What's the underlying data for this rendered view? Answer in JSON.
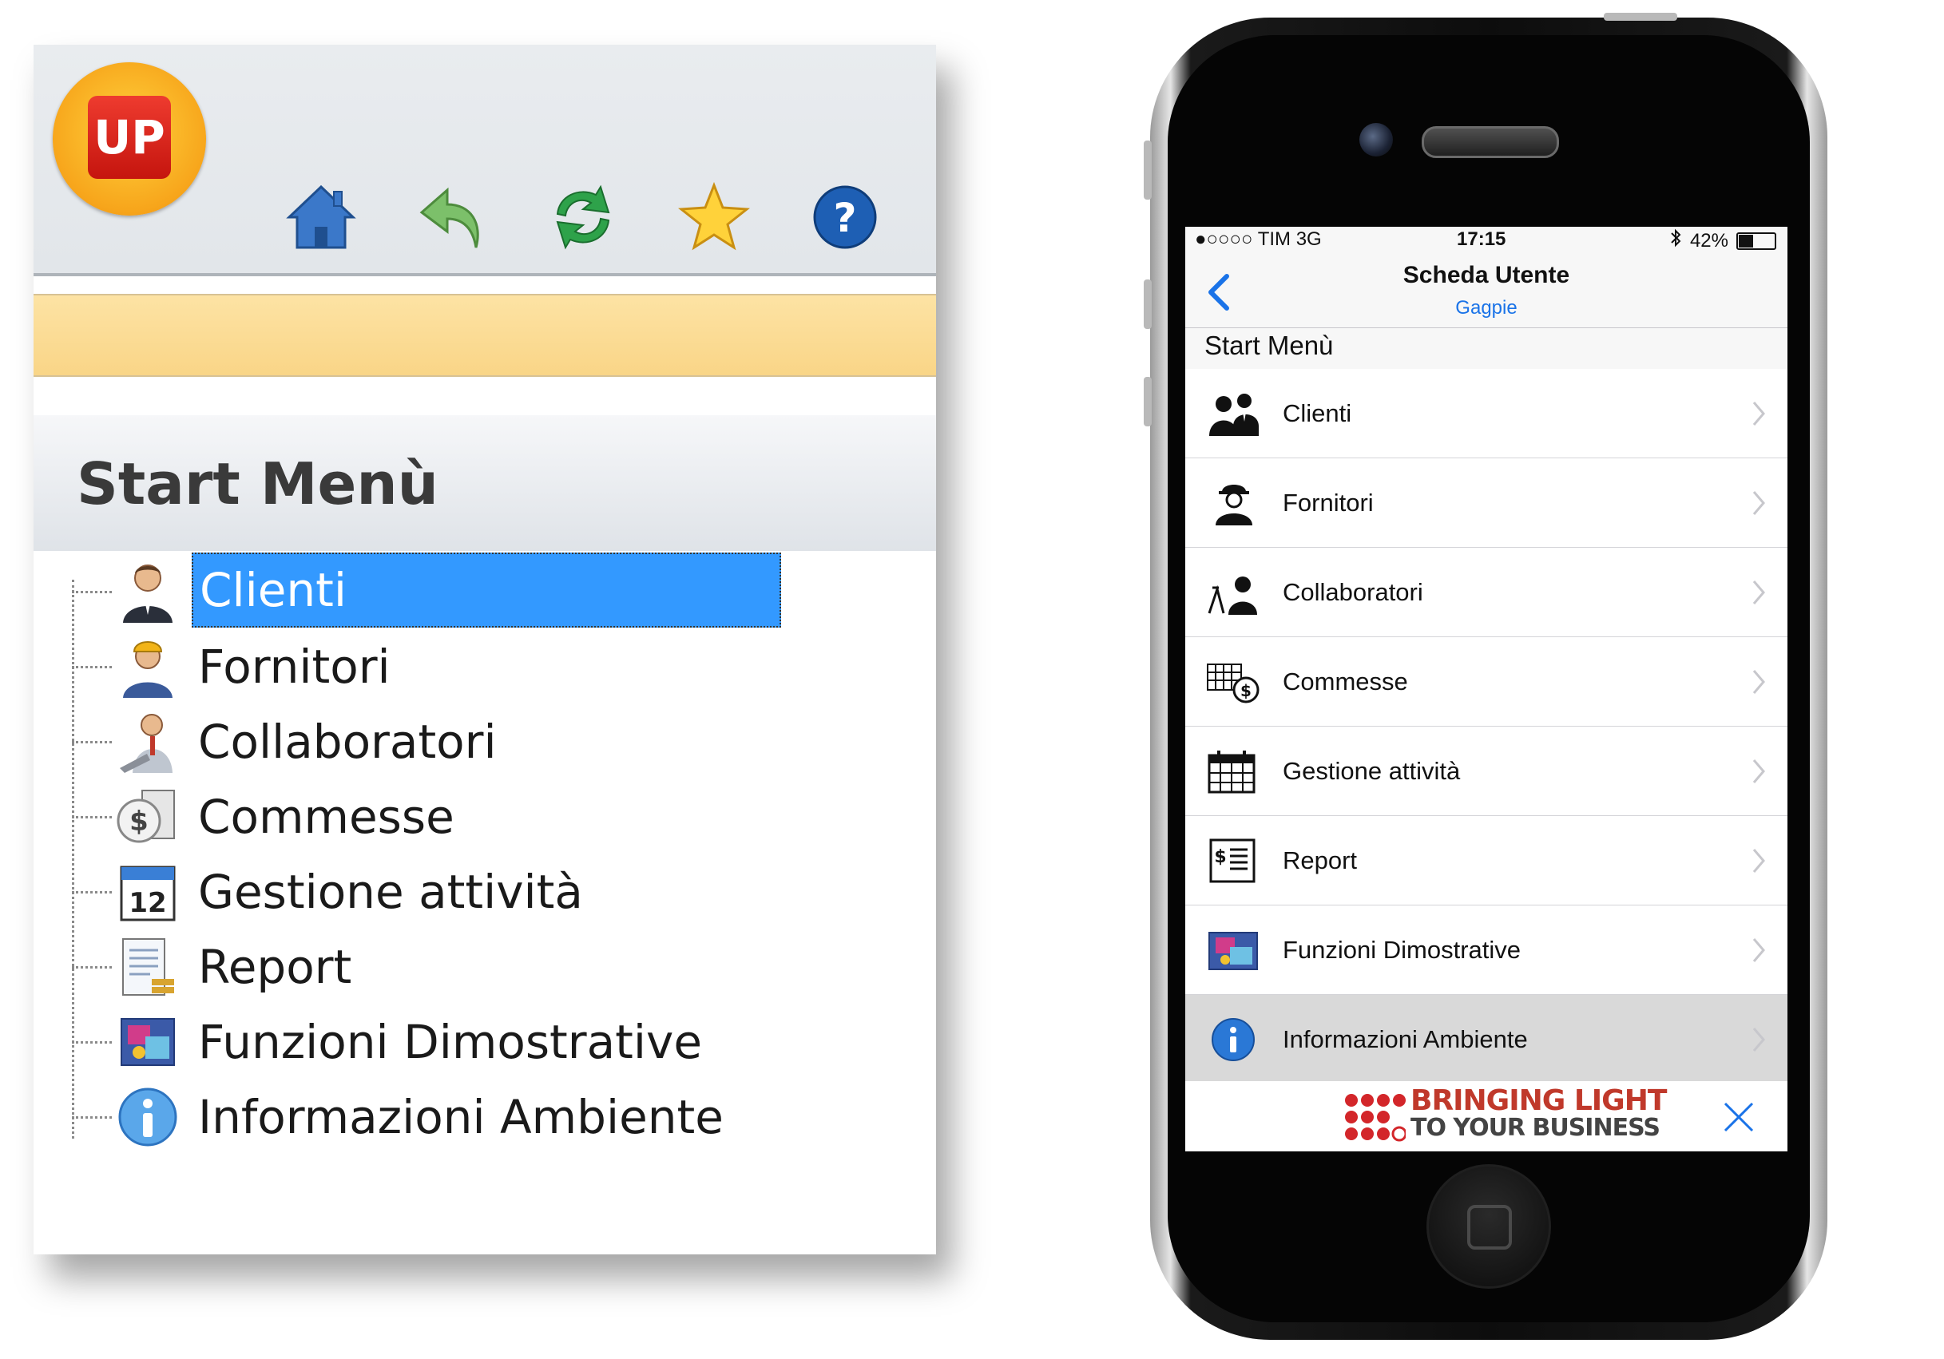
{
  "desktop": {
    "logo_text": "UP",
    "toolbar": [
      {
        "name": "home-button",
        "icon": "home-icon"
      },
      {
        "name": "back-button",
        "icon": "back-arrow-icon"
      },
      {
        "name": "refresh-button",
        "icon": "refresh-icon"
      },
      {
        "name": "favorites-button",
        "icon": "star-icon"
      },
      {
        "name": "help-button",
        "icon": "help-icon"
      }
    ],
    "section_title": "Start Menù",
    "menu": [
      {
        "label": "Clienti",
        "icon": "client-icon",
        "selected": true
      },
      {
        "label": "Fornitori",
        "icon": "supplier-icon"
      },
      {
        "label": "Collaboratori",
        "icon": "collaborator-icon"
      },
      {
        "label": "Commesse",
        "icon": "order-icon"
      },
      {
        "label": "Gestione attività",
        "icon": "calendar-icon"
      },
      {
        "label": "Report",
        "icon": "report-icon"
      },
      {
        "label": "Funzioni Dimostrative",
        "icon": "demo-icon"
      },
      {
        "label": "Informazioni Ambiente",
        "icon": "info-icon"
      }
    ]
  },
  "phone": {
    "status": {
      "carrier": "●○○○○ TIM   3G",
      "time": "17:15",
      "battery": "42%",
      "battery_level": 0.42
    },
    "nav": {
      "title": "Scheda Utente",
      "subtitle": "Gagpie",
      "back_icon": "chevron-left-icon"
    },
    "section_title": "Start Menù",
    "menu": [
      {
        "label": "Clienti",
        "icon": "clients-icon"
      },
      {
        "label": "Fornitori",
        "icon": "supplier-icon"
      },
      {
        "label": "Collaboratori",
        "icon": "collaborator-icon"
      },
      {
        "label": "Commesse",
        "icon": "orders-icon"
      },
      {
        "label": "Gestione attività",
        "icon": "calendar-icon"
      },
      {
        "label": "Report",
        "icon": "report-icon"
      },
      {
        "label": "Funzioni Dimostrative",
        "icon": "demo-icon"
      },
      {
        "label": "Informazioni Ambiente",
        "icon": "info-icon",
        "highlighted": true
      }
    ],
    "banner": {
      "line1": "BRINGING LIGHT",
      "line2": "TO YOUR BUSINESS",
      "close_icon": "close-icon"
    }
  },
  "colors": {
    "selection": "#3399ff",
    "toolbar_bar": "#f9d587",
    "ios_link": "#1a73e8",
    "banner_red": "#c0392b"
  }
}
